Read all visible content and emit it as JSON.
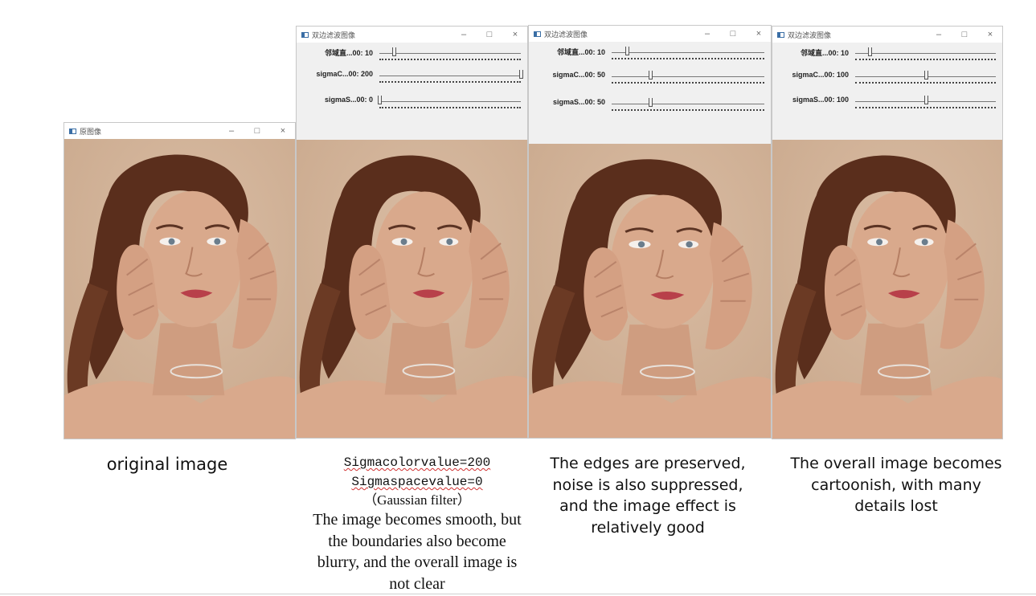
{
  "windows": [
    {
      "title": "原图像",
      "trackbars": []
    },
    {
      "title": "双边滤波图像",
      "trackbars": [
        {
          "label": "邻域直...00: 10",
          "value": 10,
          "max": 100
        },
        {
          "label": "sigmaC...00: 200",
          "value": 200,
          "max": 200
        },
        {
          "label": "sigmaS...00: 0",
          "value": 0,
          "max": 200
        }
      ]
    },
    {
      "title": "双边滤波图像",
      "trackbars": [
        {
          "label": "邻域直...00: 10",
          "value": 10,
          "max": 100
        },
        {
          "label": "sigmaC...00: 50",
          "value": 50,
          "max": 200
        },
        {
          "label": "sigmaS...00: 50",
          "value": 50,
          "max": 200
        }
      ]
    },
    {
      "title": "双边滤波图像",
      "trackbars": [
        {
          "label": "邻域直...00: 10",
          "value": 10,
          "max": 100
        },
        {
          "label": "sigmaC...00: 100",
          "value": 100,
          "max": 200
        },
        {
          "label": "sigmaS...00: 100",
          "value": 100,
          "max": 200
        }
      ]
    }
  ],
  "window_controls": {
    "minimize": "–",
    "maximize": "□",
    "close": "×"
  },
  "captions": {
    "c1": "original image",
    "c2_line1": "Sigmacolorvalue=200",
    "c2_line2": "Sigmaspacevalue=0",
    "c2_line3": "（Gaussian filter）",
    "c2_body": "The image becomes smooth, but the boundaries also become blurry, and the overall image is not clear",
    "c3": "The edges are preserved, noise is also suppressed, and the image effect is relatively good",
    "c4": "The overall image becomes cartoonish, with many details lost"
  },
  "colors": {
    "panel": "#f0f0f0",
    "backdrop": "#c9a88c",
    "hair": "#5a2e1c",
    "skin": "#d9a98c"
  }
}
